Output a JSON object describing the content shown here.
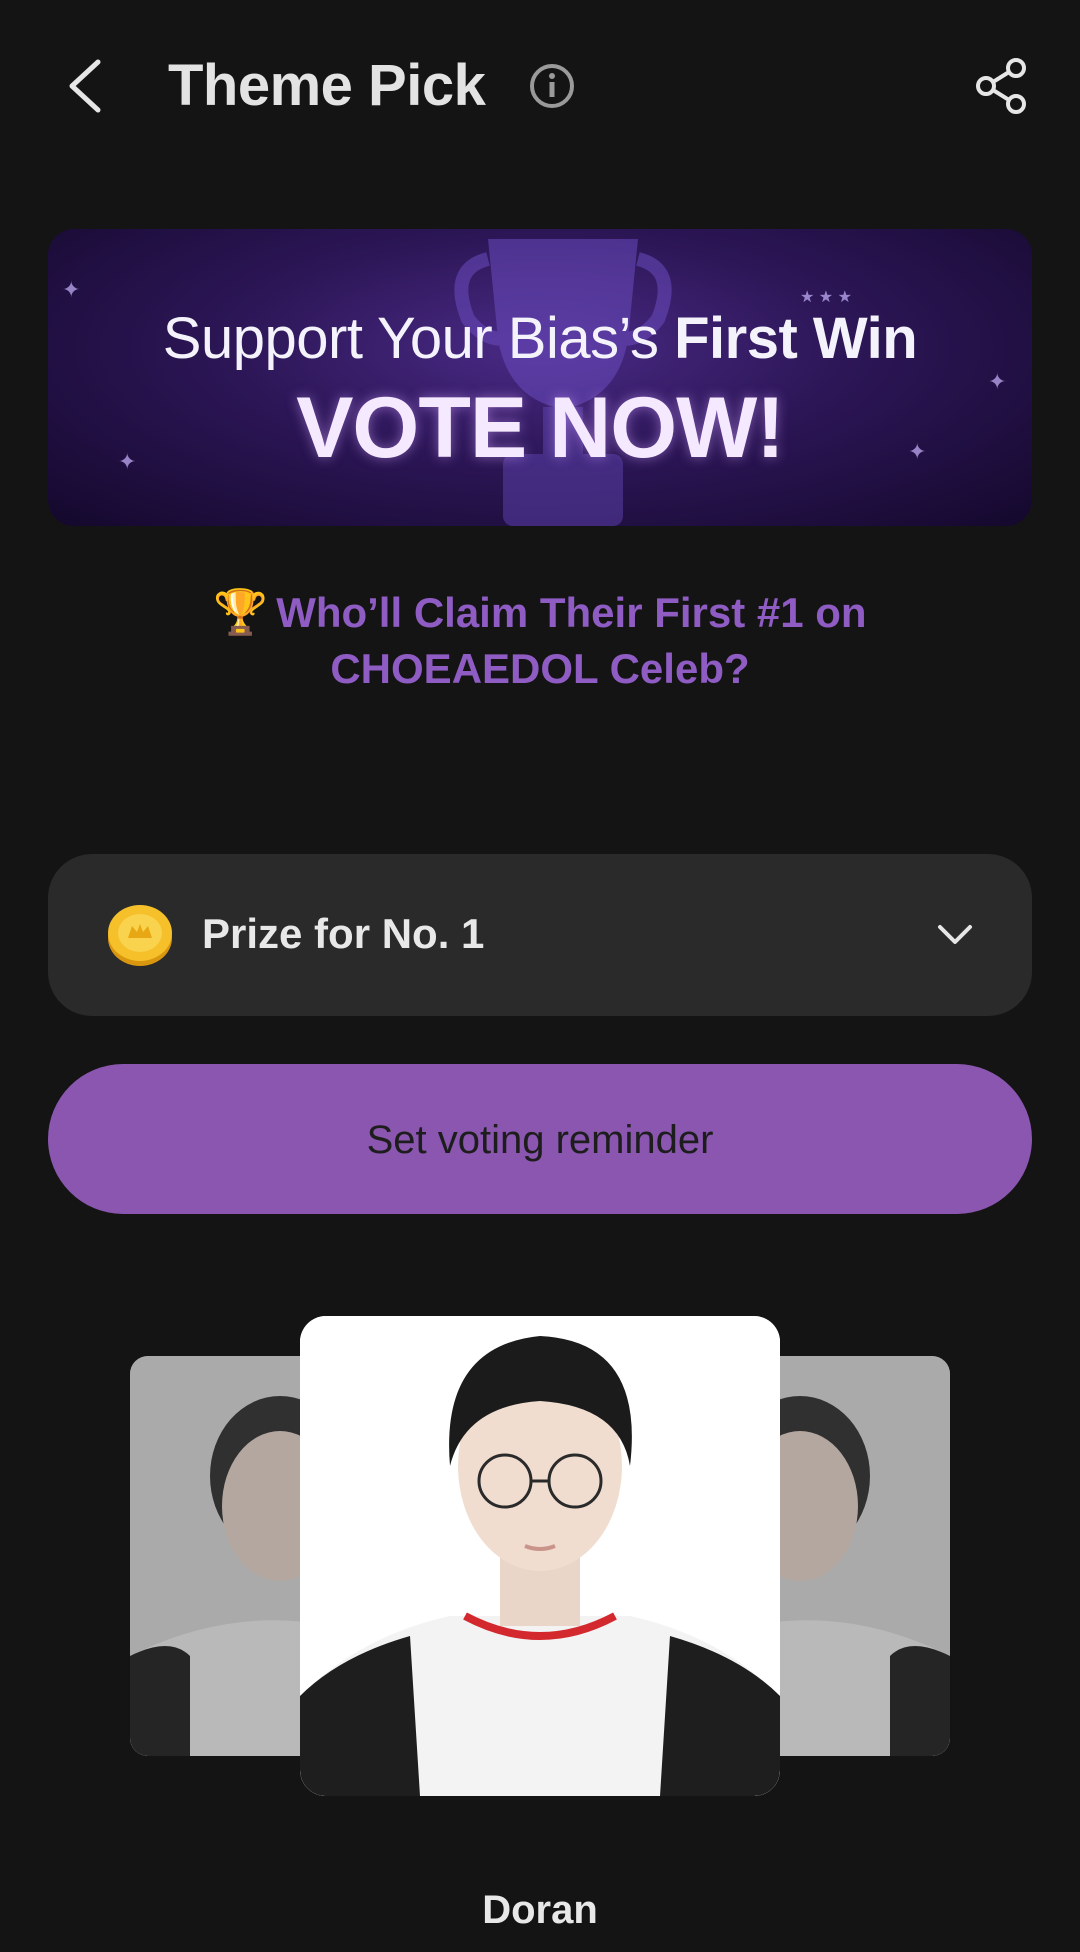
{
  "header": {
    "title": "Theme Pick",
    "back_icon": "chevron-left-icon",
    "info_icon": "info-icon",
    "share_icon": "share-icon"
  },
  "banner": {
    "line1_prefix": "Support Your Bias’s",
    "line1_highlight": "First Win",
    "line2": "VOTE NOW!"
  },
  "headline": {
    "emoji": "🏆",
    "text": "Who’ll Claim Their First #1 on CHOEAEDOL Celeb?"
  },
  "prize": {
    "label": "Prize for No. 1",
    "coin_icon": "coin-icon",
    "expand_icon": "chevron-down-icon"
  },
  "reminder": {
    "label": "Set voting reminder"
  },
  "candidate": {
    "name": "Doran"
  },
  "colors": {
    "background": "#141414",
    "accent": "#8b56b0",
    "headline": "#8e5cc2",
    "card": "#2a2a2a"
  }
}
